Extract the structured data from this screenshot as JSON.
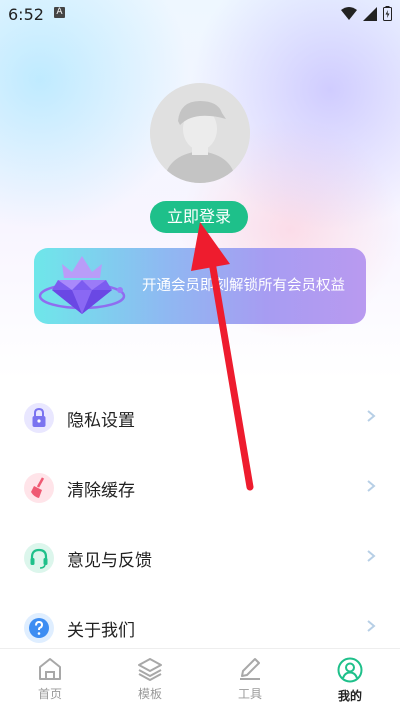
{
  "status_bar": {
    "time": "6:52",
    "notification_badge": "A"
  },
  "profile": {
    "login_label": "立即登录"
  },
  "vip_banner": {
    "text": "开通会员即刻解锁所有会员权益"
  },
  "menu": [
    {
      "label": "隐私设置",
      "icon": "lock-icon",
      "color": "#7a73f0",
      "bg": "#e9e7ff"
    },
    {
      "label": "清除缓存",
      "icon": "broom-icon",
      "color": "#ef5a73",
      "bg": "#ffe4e9"
    },
    {
      "label": "意见与反馈",
      "icon": "headset-icon",
      "color": "#1ec08a",
      "bg": "#dcf6ec"
    },
    {
      "label": "关于我们",
      "icon": "question-icon",
      "color": "#3d8df2",
      "bg": "#dfeeff"
    }
  ],
  "tabbar": {
    "tabs": [
      {
        "label": "首页",
        "icon": "home-icon",
        "active": false
      },
      {
        "label": "模板",
        "icon": "layers-icon",
        "active": false
      },
      {
        "label": "工具",
        "icon": "pencil-icon",
        "active": false
      },
      {
        "label": "我的",
        "icon": "profile-icon",
        "active": true
      }
    ]
  },
  "colors": {
    "accent": "#1ec08a",
    "annotation_arrow": "#ee1c2e"
  }
}
